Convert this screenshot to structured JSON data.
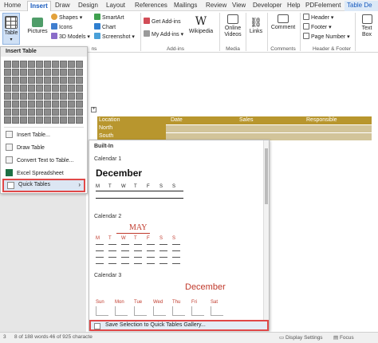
{
  "tabs": [
    {
      "label": "Home"
    },
    {
      "label": "Insert"
    },
    {
      "label": "Draw"
    },
    {
      "label": "Design"
    },
    {
      "label": "Layout"
    },
    {
      "label": "References"
    },
    {
      "label": "Mailings"
    },
    {
      "label": "Review"
    },
    {
      "label": "View"
    },
    {
      "label": "Developer"
    },
    {
      "label": "Help"
    },
    {
      "label": "PDFelement"
    },
    {
      "label": "Table De"
    }
  ],
  "ribbon": {
    "table_label": "Table",
    "pictures_label": "Pictures",
    "shapes_label": "Shapes",
    "icons_label": "Icons",
    "models_label": "3D Models",
    "smartart_label": "SmartArt",
    "chart_label": "Chart",
    "screenshot_label": "Screenshot",
    "getaddins_label": "Get Add-ins",
    "myaddins_label": "My Add-ins",
    "wikipedia_label": "Wikipedia",
    "onlinevideos_label": "Online Videos",
    "links_label": "Links",
    "comment_label": "Comment",
    "header_label": "Header",
    "footer_label": "Footer",
    "pagenumber_label": "Page Number",
    "textbox_label": "Text Box",
    "groups": {
      "illustrations": "ns",
      "addins": "Add-ins",
      "media": "Media",
      "comments": "Comments",
      "headerfooter": "Header & Footer"
    }
  },
  "table_menu": {
    "title": "Insert Table",
    "items": [
      {
        "label": "Insert Table..."
      },
      {
        "label": "Draw Table"
      },
      {
        "label": "Convert Text to Table..."
      },
      {
        "label": "Excel Spreadsheet"
      },
      {
        "label": "Quick Tables"
      }
    ]
  },
  "doc_table": {
    "headers": [
      "Location",
      "Date",
      "Sales",
      "Responsible"
    ],
    "rows": [
      "North",
      "South"
    ]
  },
  "gallery": {
    "section": "Built-In",
    "cal1": {
      "title": "Calendar 1",
      "month": "December",
      "days": [
        "M",
        "T",
        "W",
        "T",
        "F",
        "S",
        "S"
      ]
    },
    "cal2": {
      "title": "Calendar 2",
      "month": "MAY",
      "days": [
        "M",
        "T",
        "W",
        "T",
        "F",
        "S",
        "S"
      ]
    },
    "cal3": {
      "title": "Calendar 3",
      "month": "December",
      "days": [
        "Sun",
        "Mon",
        "Tue",
        "Wed",
        "Thu",
        "Fri",
        "Sat"
      ]
    },
    "save_label": "Save Selection to Quick Tables Gallery..."
  },
  "status": {
    "page": "3",
    "words": "8 of 188 words",
    "characters": "46 of 925 characte",
    "display": "Display Settings",
    "focus": "Focus"
  },
  "colors": {
    "accent": "#185abd",
    "gold": "#b8962e",
    "tan": "#d2c49a",
    "red": "#c0392b",
    "highlight": "#e04848"
  }
}
